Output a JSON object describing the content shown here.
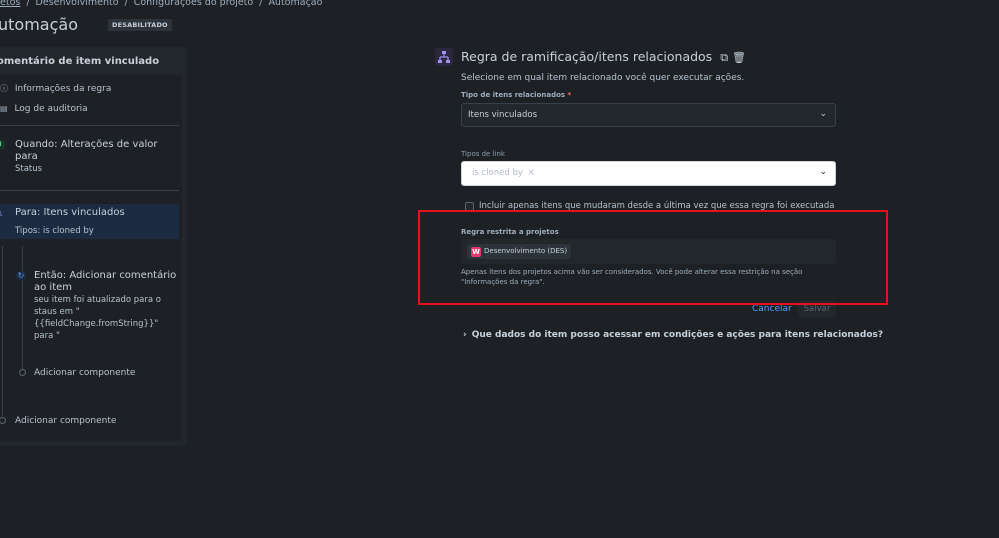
{
  "breadcrumb": {
    "items": [
      "etos",
      "Desenvolvimento",
      "Configurações do projeto",
      "Automação"
    ],
    "separator": "/"
  },
  "header": {
    "title": "utomação",
    "status": "DESABILITADO"
  },
  "rule_panel": {
    "title": "omentário de item vinculado",
    "nav": [
      {
        "label": "Informações da regra",
        "icon": "info-icon"
      },
      {
        "label": "Log de auditoria",
        "icon": "audit-log-icon"
      }
    ],
    "trigger": {
      "title": "Quando: Alterações de valor para",
      "subtitle": "Status",
      "icon": "trigger-icon"
    },
    "branch": {
      "title": "Para: Itens vinculados",
      "subtitle": "Tipos: is cloned by",
      "icon": "branch-icon"
    },
    "action": {
      "title": "Então: Adicionar comentário ao item",
      "subtitle": "seu item foi atualizado para o staus em \"{{fieldChange.fromString}}\" para \"",
      "icon": "refresh-icon"
    },
    "add_component_inner": "Adicionar componente",
    "add_component_outer": "Adicionar componente"
  },
  "form": {
    "title": "Regra de ramificação/itens relacionados",
    "description": "Selecione em qual item relacionado você quer executar ações.",
    "related_type": {
      "label": "Tipo de itens relacionados",
      "required_mark": "*",
      "value": "Itens vinculados"
    },
    "link_types": {
      "label": "Tipos de link",
      "value": "is cloned by",
      "remove_glyph": "×"
    },
    "checkbox_label": "Incluir apenas itens que mudaram desde a última vez que essa regra foi executada",
    "restricted": {
      "label": "Regra restrita a projetos",
      "project": "Desenvolvimento (DES)",
      "project_logo_letter": "W",
      "help": "Apenas itens dos projetos acima vão ser considerados. Você pode alterar essa restrição na seção \"Informações da regra\"."
    },
    "cancel": "Cancelar",
    "save": "Salvar",
    "faq": "Que dados do item posso acessar em condições e ações para itens relacionados?"
  },
  "colors": {
    "background": "#1d2125",
    "panel": "#22272b",
    "accent_link": "#579dff",
    "highlight": "#e8101b",
    "branch_selected": "#1c2b41"
  }
}
